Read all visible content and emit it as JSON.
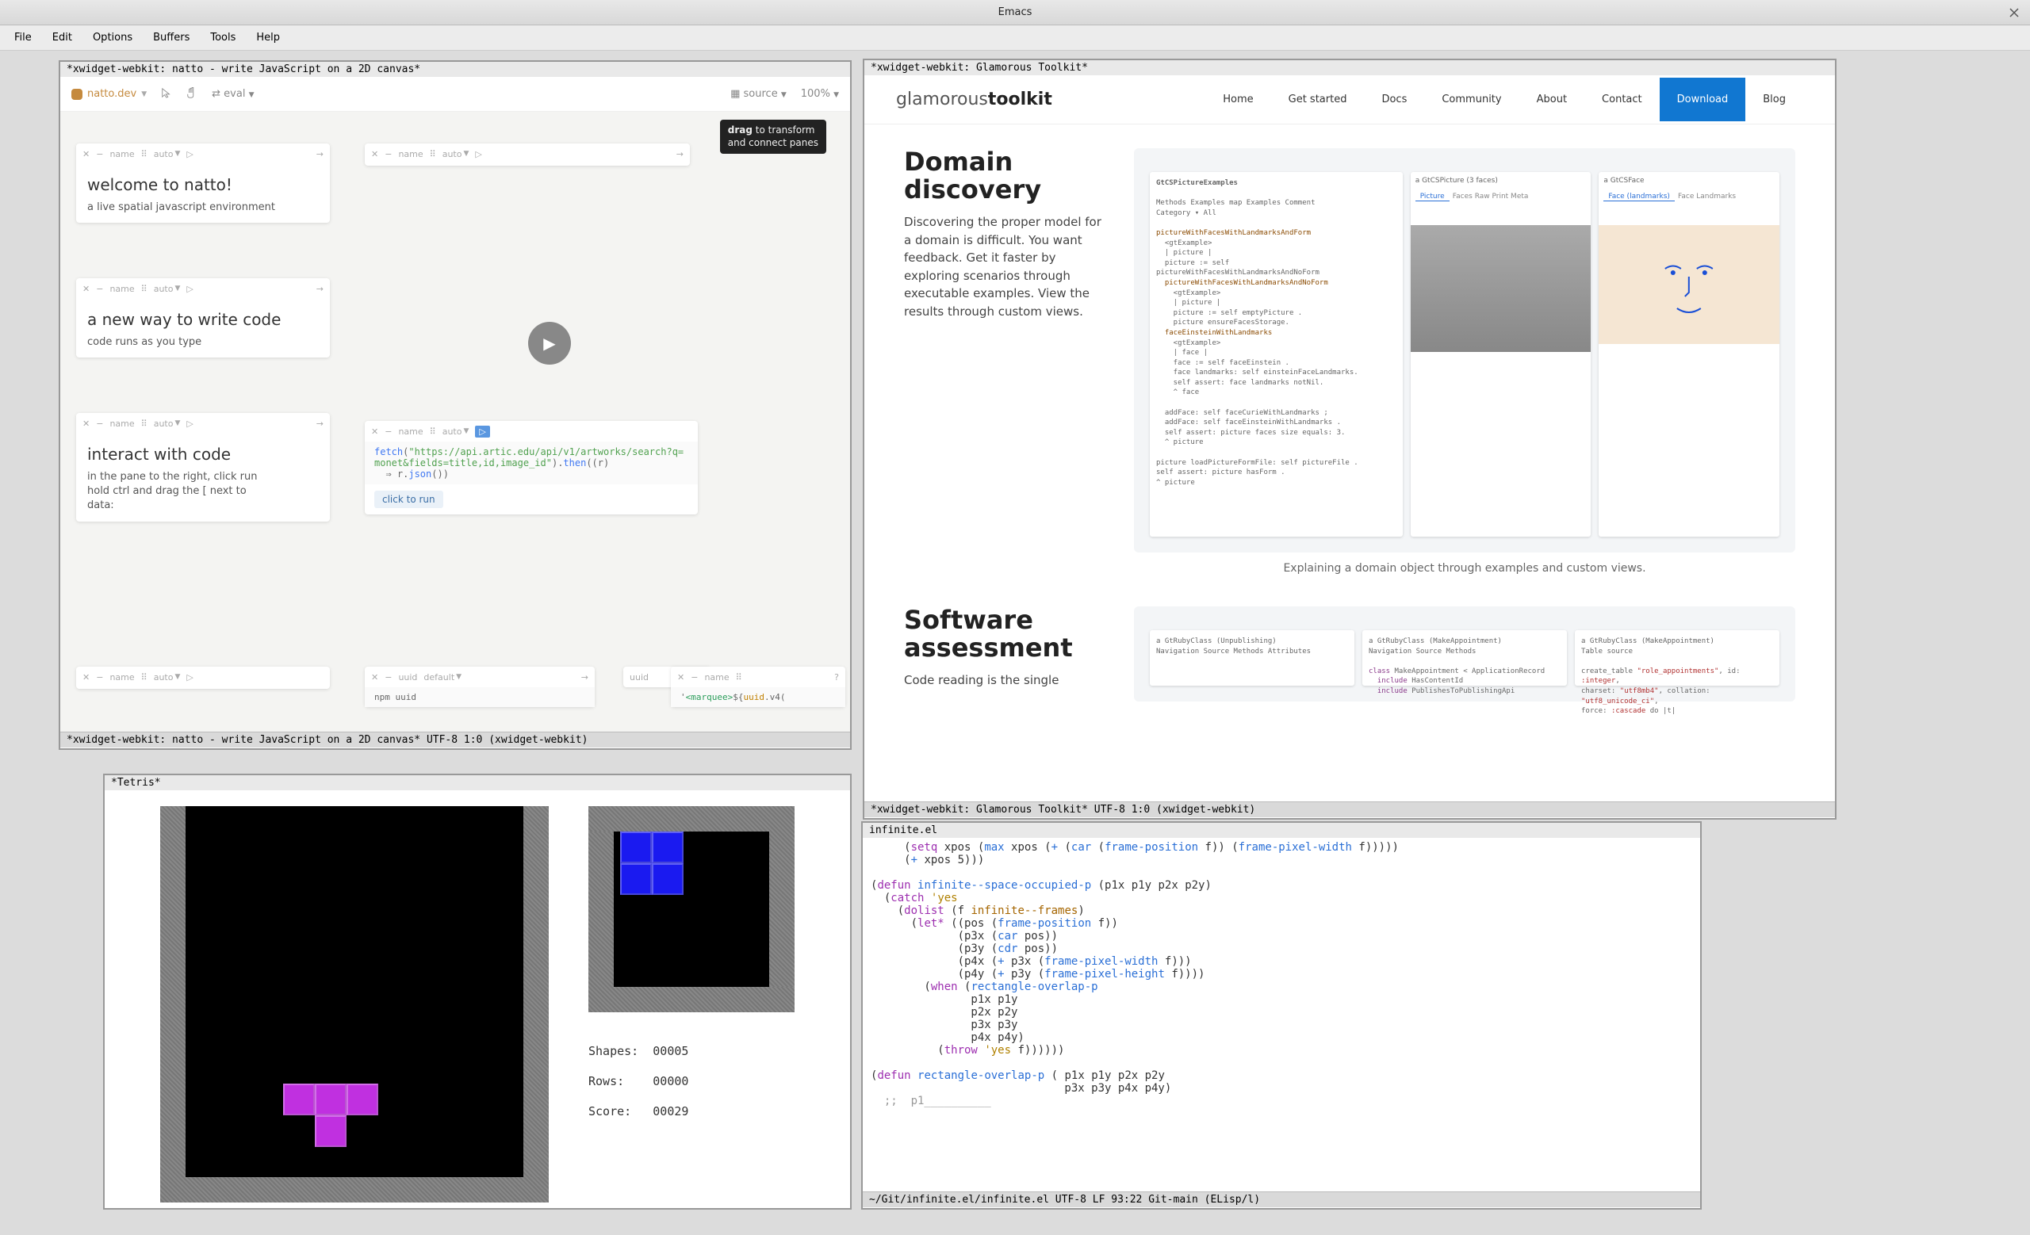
{
  "app": {
    "title": "Emacs"
  },
  "menubar": [
    "File",
    "Edit",
    "Options",
    "Buffers",
    "Tools",
    "Help"
  ],
  "natto": {
    "header": "*xwidget-webkit: natto - write JavaScript on a 2D canvas*",
    "modeline": " *xwidget-webkit: natto - write JavaScript on a 2D canvas* UTF-8 1:0 (xwidget-webkit)",
    "logo": "natto.dev",
    "eval": "eval",
    "source": "source",
    "zoom": "100%",
    "tooltip": "drag to transform\nand connect panes",
    "toolbar": {
      "name": "name",
      "auto": "auto",
      "uuid": "uuid",
      "default": "default"
    },
    "panes": {
      "p1": {
        "title": "welcome to natto!",
        "text": "a live spatial javascript environment"
      },
      "p2": {
        "title": "a new way to write code",
        "text": "code runs as you type"
      },
      "p3": {
        "title": "interact with code",
        "text": "in the pane to the right, click run\nhold ctrl and drag the [ next to\ndata:"
      },
      "p4": {
        "code_html": "<span class='code-fn'>fetch</span>(<span class='code-str'>\"https://api.artic.edu/api/v1/artworks/search?q=monet&fields=title,id,image_id\"</span>).<span class='code-fn'>then</span>((<span class='code-var'>r</span>)\n  ⇒ r.<span class='code-fn'>json</span>())",
        "button": "click to run"
      },
      "p5": {
        "marquee_html": "'<span style=\"color:#2a9d5a\">&lt;marquee&gt;</span>${<span style=\"color:#c08000\">uuid</span>.v4("
      }
    },
    "npm_uuid": "npm  uuid"
  },
  "glam": {
    "header": "*xwidget-webkit: Glamorous Toolkit*",
    "modeline": " *xwidget-webkit: Glamorous Toolkit* UTF-8 1:0 (xwidget-webkit)",
    "brand_light": "glamorous",
    "brand_bold": "toolkit",
    "nav": [
      "Home",
      "Get started",
      "Docs",
      "Community",
      "About",
      "Contact",
      "Download",
      "Blog"
    ],
    "nav_active": "Download",
    "section1": {
      "title": "Domain discovery",
      "text": "Discovering the proper model for a domain is difficult. You want feedback. Get it faster by exploring scenarios through executable examples. View the results through custom views.",
      "panel_title": "GtCSPictureExamples",
      "tab1": "a GtCSPicture (3 faces)",
      "tab2": "a GtCSFace",
      "caption": "Explaining a domain object through examples and custom views."
    },
    "section2": {
      "title": "Software assessment",
      "text": "Code reading is the single"
    }
  },
  "tetris": {
    "header": "*Tetris*",
    "stats": {
      "shapes_label": "Shapes:",
      "shapes_value": "00005",
      "rows_label": "Rows:",
      "rows_value": "00000",
      "score_label": "Score:",
      "score_value": "00029"
    }
  },
  "elisp": {
    "header": "infinite.el",
    "modeline": " ~/Git/infinite.el/infinite.el UTF-8 LF 93:22 Git-main (ELisp/l)",
    "code_html": "     (<span class='el-kw'>setq</span> xpos (<span class='el-fn'>max</span> xpos (<span class='el-fn'>+</span> (<span class='el-fn'>car</span> (<span class='el-fn'>frame-position</span> f)) (<span class='el-fn'>frame-pixel-width</span> f)))))\n     (<span class='el-fn'>+</span> xpos 5)))\n\n(<span class='el-kw'>defun</span> <span class='el-fn'>infinite--space-occupied-p</span> (p1x p1y p2x p2y)\n  (<span class='el-kw'>catch</span> <span class='el-str'>'yes</span>\n    (<span class='el-kw'>dolist</span> (f <span class='el-var'>infinite--frames</span>)\n      (<span class='el-kw'>let*</span> ((pos (<span class='el-fn'>frame-position</span> f))\n             (p3x (<span class='el-fn'>car</span> pos))\n             (p3y (<span class='el-fn'>cdr</span> pos))\n             (p4x (<span class='el-fn'>+</span> p3x (<span class='el-fn'>frame-pixel-width</span> f)))\n             (p4y (<span class='el-fn'>+</span> p3y (<span class='el-fn'>frame-pixel-height</span> f))))\n        (<span class='el-kw'>when</span> (<span class='el-fn'>rectangle-overlap-p</span>\n               p1x p1y\n               p2x p2y\n               p3x p3y\n               p4x p4y)\n          (<span class='el-kw'>throw</span> <span class='el-str'>'yes</span> f))))))\n\n(<span class='el-kw'>defun</span> <span class='el-fn'>rectangle-overlap-p</span> ( p1x p1y p2x p2y\n                             p3x p3y p4x p4y)\n  <span class='el-comment'>;;  p1__________</span>\n"
  }
}
